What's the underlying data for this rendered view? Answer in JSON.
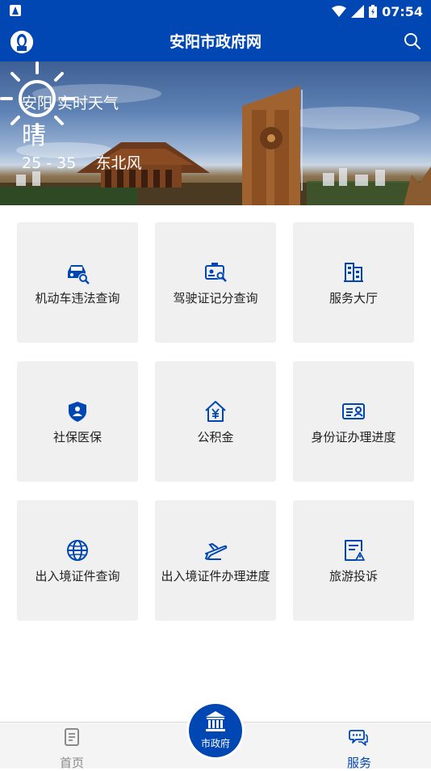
{
  "status_bar": {
    "time": "07:54",
    "icons": [
      "sim-icon",
      "wifi-icon",
      "signal-icon",
      "battery-icon"
    ]
  },
  "app_bar": {
    "title": "安阳市政府网",
    "left_icon": "user-avatar-icon",
    "right_icon": "search-icon"
  },
  "weather": {
    "city_label": "安阳 实时天气",
    "condition": "晴",
    "temp_wind": "25 - 35    东北风",
    "icon": "sun-icon"
  },
  "services": [
    {
      "label": "机动车违法查询",
      "icon": "car-search-icon"
    },
    {
      "label": "驾驶证记分查询",
      "icon": "license-search-icon"
    },
    {
      "label": "服务大厅",
      "icon": "building-icon"
    },
    {
      "label": "社保医保",
      "icon": "shield-user-icon"
    },
    {
      "label": "公积金",
      "icon": "house-yuan-icon"
    },
    {
      "label": "身份证办理进度",
      "icon": "id-card-icon"
    },
    {
      "label": "出入境证件查询",
      "icon": "globe-icon"
    },
    {
      "label": "出入境证件办理进度",
      "icon": "airplane-icon"
    },
    {
      "label": "旅游投诉",
      "icon": "complaint-doc-icon"
    }
  ],
  "tab_bar": {
    "home": {
      "label": "首页",
      "icon": "document-icon"
    },
    "center": {
      "label": "市政府",
      "icon": "government-building-icon"
    },
    "service": {
      "label": "服务",
      "icon": "chat-bubbles-icon"
    }
  },
  "colors": {
    "brand_blue": "#0047b3",
    "tile_bg": "#f0f0f0",
    "inactive_gray": "#8a8a8a"
  }
}
